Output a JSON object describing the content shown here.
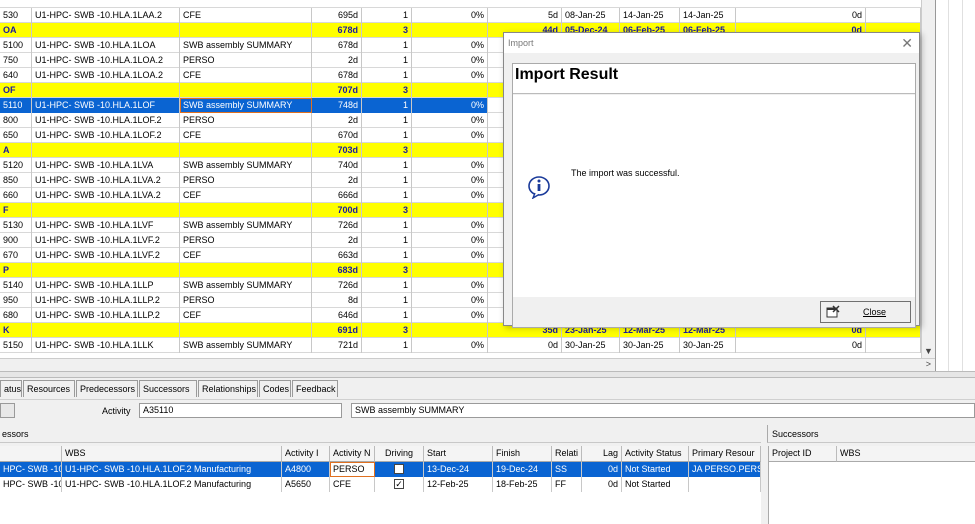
{
  "grid": {
    "rows": [
      {
        "type": "act",
        "id": "530",
        "wbs": "U1-HPC- SWB -10.HLA.1LAA.2",
        "name": "CFE",
        "dur": "695d",
        "steps": "1",
        "pct": "0%",
        "float": "5d",
        "start": "08-Jan-25",
        "finish": "14-Jan-25",
        "finish2": "14-Jan-25",
        "tf": "0d"
      },
      {
        "type": "wbs",
        "id": "OA",
        "wbs": "",
        "name": "",
        "dur": "678d",
        "steps": "3",
        "pct": "",
        "float": "44d",
        "start": "05-Dec-24",
        "finish": "06-Feb-25",
        "finish2": "06-Feb-25",
        "tf": "0d"
      },
      {
        "type": "act",
        "id": "5100",
        "wbs": "U1-HPC- SWB -10.HLA.1LOA",
        "name": "SWB assembly SUMMARY",
        "dur": "678d",
        "steps": "1",
        "pct": "0%",
        "float": "",
        "start": "",
        "finish": "",
        "finish2": "",
        "tf": "0d"
      },
      {
        "type": "act",
        "id": "750",
        "wbs": "U1-HPC- SWB -10.HLA.1LOA.2",
        "name": "PERSO",
        "dur": "2d",
        "steps": "1",
        "pct": "0%",
        "float": "",
        "start": "",
        "finish": "",
        "finish2": "",
        "tf": "0d"
      },
      {
        "type": "act",
        "id": "640",
        "wbs": "U1-HPC- SWB -10.HLA.1LOA.2",
        "name": "CFE",
        "dur": "678d",
        "steps": "1",
        "pct": "0%",
        "float": "",
        "start": "",
        "finish": "",
        "finish2": "",
        "tf": "0d"
      },
      {
        "type": "wbs",
        "id": "OF",
        "wbs": "",
        "name": "",
        "dur": "707d",
        "steps": "3",
        "pct": "",
        "float": "",
        "start": "",
        "finish": "",
        "finish2": "",
        "tf": "0d"
      },
      {
        "type": "act",
        "sel": true,
        "id": "5110",
        "wbs": "U1-HPC- SWB -10.HLA.1LOF",
        "name": "SWB assembly SUMMARY",
        "dur": "748d",
        "steps": "1",
        "pct": "0%",
        "float": "",
        "start": "",
        "finish": "",
        "finish2": "",
        "tf": "0d"
      },
      {
        "type": "act",
        "id": "800",
        "wbs": "U1-HPC- SWB -10.HLA.1LOF.2",
        "name": "PERSO",
        "dur": "2d",
        "steps": "1",
        "pct": "0%",
        "float": "",
        "start": "",
        "finish": "",
        "finish2": "",
        "tf": "0d"
      },
      {
        "type": "act",
        "id": "650",
        "wbs": "U1-HPC- SWB -10.HLA.1LOF.2",
        "name": "CFE",
        "dur": "670d",
        "steps": "1",
        "pct": "0%",
        "float": "",
        "start": "",
        "finish": "",
        "finish2": "",
        "tf": "0d"
      },
      {
        "type": "wbs",
        "id": "A",
        "wbs": "",
        "name": "",
        "dur": "703d",
        "steps": "3",
        "pct": "",
        "float": "",
        "start": "",
        "finish": "",
        "finish2": "",
        "tf": "0d"
      },
      {
        "type": "act",
        "id": "5120",
        "wbs": "U1-HPC- SWB -10.HLA.1LVA",
        "name": "SWB assembly SUMMARY",
        "dur": "740d",
        "steps": "1",
        "pct": "0%",
        "float": "",
        "start": "",
        "finish": "",
        "finish2": "",
        "tf": "0d"
      },
      {
        "type": "act",
        "id": "850",
        "wbs": "U1-HPC- SWB -10.HLA.1LVA.2",
        "name": "PERSO",
        "dur": "2d",
        "steps": "1",
        "pct": "0%",
        "float": "",
        "start": "",
        "finish": "",
        "finish2": "",
        "tf": "0d"
      },
      {
        "type": "act",
        "id": "660",
        "wbs": "U1-HPC- SWB -10.HLA.1LVA.2",
        "name": "CEF",
        "dur": "666d",
        "steps": "1",
        "pct": "0%",
        "float": "",
        "start": "",
        "finish": "",
        "finish2": "",
        "tf": "0d"
      },
      {
        "type": "wbs",
        "id": "F",
        "wbs": "",
        "name": "",
        "dur": "700d",
        "steps": "3",
        "pct": "",
        "float": "",
        "start": "",
        "finish": "",
        "finish2": "",
        "tf": "0d"
      },
      {
        "type": "act",
        "id": "5130",
        "wbs": "U1-HPC- SWB -10.HLA.1LVF",
        "name": "SWB assembly SUMMARY",
        "dur": "726d",
        "steps": "1",
        "pct": "0%",
        "float": "",
        "start": "",
        "finish": "",
        "finish2": "",
        "tf": "0d"
      },
      {
        "type": "act",
        "id": "900",
        "wbs": "U1-HPC- SWB -10.HLA.1LVF.2",
        "name": "PERSO",
        "dur": "2d",
        "steps": "1",
        "pct": "0%",
        "float": "",
        "start": "",
        "finish": "",
        "finish2": "",
        "tf": "0d"
      },
      {
        "type": "act",
        "id": "670",
        "wbs": "U1-HPC- SWB -10.HLA.1LVF.2",
        "name": "CEF",
        "dur": "663d",
        "steps": "1",
        "pct": "0%",
        "float": "",
        "start": "",
        "finish": "",
        "finish2": "",
        "tf": "0d"
      },
      {
        "type": "wbs",
        "id": "P",
        "wbs": "",
        "name": "",
        "dur": "683d",
        "steps": "3",
        "pct": "",
        "float": "",
        "start": "",
        "finish": "",
        "finish2": "",
        "tf": "0d"
      },
      {
        "type": "act",
        "id": "5140",
        "wbs": "U1-HPC- SWB -10.HLA.1LLP",
        "name": "SWB assembly SUMMARY",
        "dur": "726d",
        "steps": "1",
        "pct": "0%",
        "float": "",
        "start": "",
        "finish": "",
        "finish2": "",
        "tf": "0d"
      },
      {
        "type": "act",
        "id": "950",
        "wbs": "U1-HPC- SWB -10.HLA.1LLP.2",
        "name": "PERSO",
        "dur": "8d",
        "steps": "1",
        "pct": "0%",
        "float": "",
        "start": "",
        "finish": "",
        "finish2": "",
        "tf": "0d"
      },
      {
        "type": "act",
        "id": "680",
        "wbs": "U1-HPC- SWB -10.HLA.1LLP.2",
        "name": "CEF",
        "dur": "646d",
        "steps": "1",
        "pct": "0%",
        "float": "",
        "start": "",
        "finish": "",
        "finish2": "",
        "tf": "0d"
      },
      {
        "type": "wbs",
        "id": "K",
        "wbs": "",
        "name": "",
        "dur": "691d",
        "steps": "3",
        "pct": "",
        "float": "35d",
        "start": "23-Jan-25",
        "finish": "12-Mar-25",
        "finish2": "12-Mar-25",
        "tf": "0d"
      },
      {
        "type": "act",
        "id": "5150",
        "wbs": "U1-HPC- SWB -10.HLA.1LLK",
        "name": "SWB assembly SUMMARY",
        "dur": "721d",
        "steps": "1",
        "pct": "0%",
        "float": "0d",
        "start": "30-Jan-25",
        "finish": "30-Jan-25",
        "finish2": "30-Jan-25",
        "tf": "0d"
      }
    ]
  },
  "tabs": [
    "atus",
    "Resources",
    "Predecessors",
    "Successors",
    "Relationships",
    "Codes",
    "Feedback"
  ],
  "activity": {
    "label": "Activity",
    "id": "A35110",
    "name": "SWB assembly SUMMARY"
  },
  "predecessors": {
    "title": "essors",
    "headers": [
      "",
      "WBS",
      "Activity I",
      "Activity N",
      "Driving",
      "Start",
      "Finish",
      "Relati",
      "Lag",
      "Activity Status",
      "Primary Resour"
    ],
    "rows": [
      {
        "sel": true,
        "proj": "HPC- SWB -10",
        "wbs": "U1-HPC- SWB -10.HLA.1LOF.2 Manufacturing",
        "aid": "A4800",
        "aname": "PERSO",
        "driving": false,
        "start": "13-Dec-24",
        "finish": "19-Dec-24",
        "rel": "SS",
        "lag": "0d",
        "status": "Not Started",
        "res": "JA PERSO.PERS"
      },
      {
        "sel": false,
        "proj": "HPC- SWB -10",
        "wbs": "U1-HPC- SWB -10.HLA.1LOF.2 Manufacturing",
        "aid": "A5650",
        "aname": "CFE",
        "driving": true,
        "start": "12-Feb-25",
        "finish": "18-Feb-25",
        "rel": "FF",
        "lag": "0d",
        "status": "Not Started",
        "res": ""
      }
    ]
  },
  "successors": {
    "title": "Successors",
    "headers": [
      "Project ID",
      "WBS"
    ]
  },
  "dialog": {
    "window_title": "Import",
    "heading": "Import Result",
    "message": "The import was successful.",
    "close_label": "Close"
  }
}
